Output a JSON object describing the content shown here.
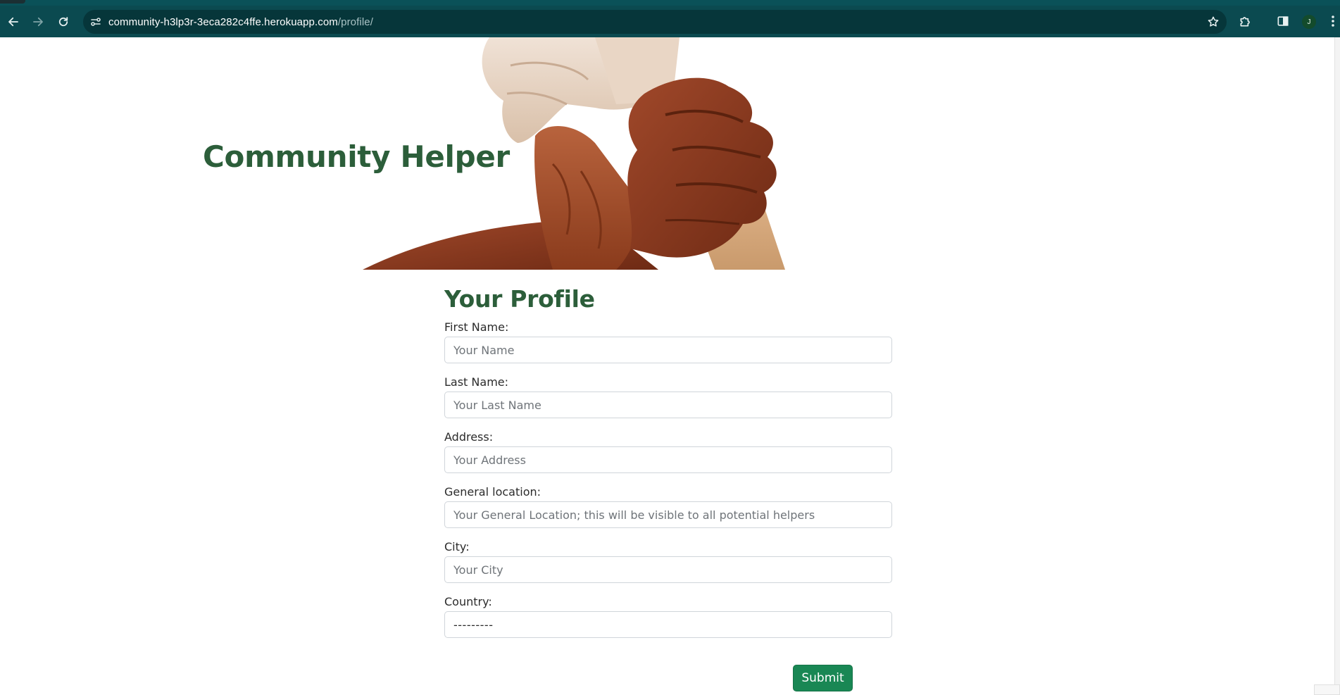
{
  "browser": {
    "url_host": "community-h3lp3r-3eca282c4ffe.herokuapp.com",
    "url_path": "/profile/",
    "profile_initial": "J",
    "icons": [
      "back-icon",
      "forward-icon",
      "reload-icon",
      "site-info-icon",
      "star-icon",
      "extensions-icon",
      "side-panel-icon",
      "menu-icon"
    ]
  },
  "header": {
    "site_title": "Community Helper",
    "hero_image": "hands-linked-icon"
  },
  "profile": {
    "heading": "Your Profile",
    "fields": [
      {
        "label": "First Name:",
        "placeholder": "Your Name",
        "value": ""
      },
      {
        "label": "Last Name:",
        "placeholder": "Your Last Name",
        "value": ""
      },
      {
        "label": "Address:",
        "placeholder": "Your Address",
        "value": ""
      },
      {
        "label": "General location:",
        "placeholder": "Your General Location; this will be visible to all potential helpers",
        "value": ""
      },
      {
        "label": "City:",
        "placeholder": "Your City",
        "value": ""
      }
    ],
    "country": {
      "label": "Country:",
      "selected": "---------"
    },
    "submit_label": "Submit"
  },
  "colors": {
    "toolbar": "#0b4a50",
    "omnibox": "#06363a",
    "heading_green": "#2c5e3a",
    "submit_green": "#198754"
  }
}
